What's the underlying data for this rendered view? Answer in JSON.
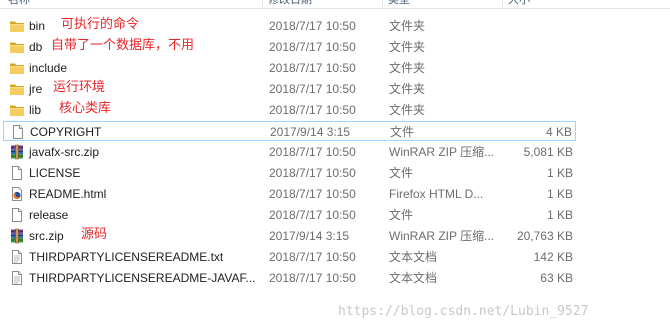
{
  "header": {
    "columns": [
      "名称",
      "修改日期",
      "类型",
      "大小"
    ]
  },
  "files": [
    {
      "name": "bin",
      "date": "2018/7/17 10:50",
      "type": "文件夹",
      "size": "",
      "icon": "folder-icon",
      "note": "可执行的命令"
    },
    {
      "name": "db",
      "date": "2018/7/17 10:50",
      "type": "文件夹",
      "size": "",
      "icon": "folder-icon",
      "note": "自带了一个数据库，不用"
    },
    {
      "name": "include",
      "date": "2018/7/17 10:50",
      "type": "文件夹",
      "size": "",
      "icon": "folder-icon",
      "note": ""
    },
    {
      "name": "jre",
      "date": "2018/7/17 10:50",
      "type": "文件夹",
      "size": "",
      "icon": "folder-icon",
      "note": "运行环境"
    },
    {
      "name": "lib",
      "date": "2018/7/17 10:50",
      "type": "文件夹",
      "size": "",
      "icon": "folder-icon",
      "note": "核心类库"
    },
    {
      "name": "COPYRIGHT",
      "date": "2017/9/14 3:15",
      "type": "文件",
      "size": "4 KB",
      "icon": "blank-file-icon",
      "note": ""
    },
    {
      "name": "javafx-src.zip",
      "date": "2018/7/17 10:50",
      "type": "WinRAR ZIP 压缩...",
      "size": "5,081 KB",
      "icon": "winrar-archive-icon",
      "note": ""
    },
    {
      "name": "LICENSE",
      "date": "2018/7/17 10:50",
      "type": "文件",
      "size": "1 KB",
      "icon": "blank-file-icon",
      "note": ""
    },
    {
      "name": "README.html",
      "date": "2018/7/17 10:50",
      "type": "Firefox HTML D...",
      "size": "1 KB",
      "icon": "firefox-html-icon",
      "note": ""
    },
    {
      "name": "release",
      "date": "2018/7/17 10:50",
      "type": "文件",
      "size": "1 KB",
      "icon": "blank-file-icon",
      "note": ""
    },
    {
      "name": "src.zip",
      "date": "2017/9/14 3:15",
      "type": "WinRAR ZIP 压缩...",
      "size": "20,763 KB",
      "icon": "winrar-archive-icon",
      "note": "源码"
    },
    {
      "name": "THIRDPARTYLICENSEREADME.txt",
      "date": "2018/7/17 10:50",
      "type": "文本文档",
      "size": "142 KB",
      "icon": "text-document-icon",
      "note": ""
    },
    {
      "name": "THIRDPARTYLICENSEREADME-JAVAF...",
      "date": "2018/7/17 10:50",
      "type": "文本文档",
      "size": "63 KB",
      "icon": "text-document-icon",
      "note": ""
    }
  ],
  "watermark": "https://blog.csdn.net/Lubin_9527",
  "colors": {
    "annotation": "#e8262a",
    "selection_border": "#99d1ff",
    "folder": "#e8b840"
  }
}
